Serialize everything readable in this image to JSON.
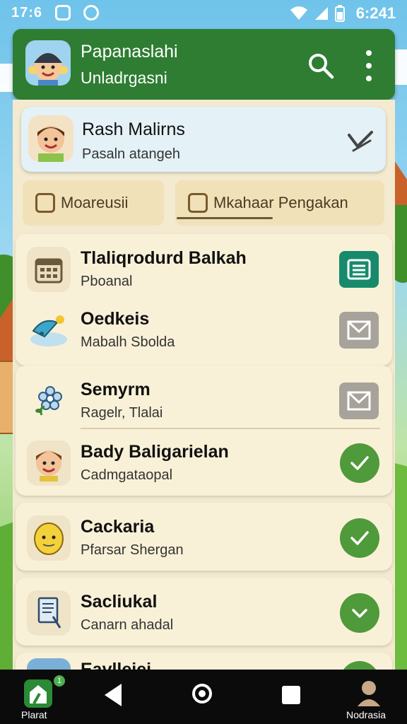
{
  "status_bar": {
    "time": "17:6",
    "clock": "6:241"
  },
  "app_bar": {
    "title": "Papanaslahi",
    "subtitle": "Unladrgasni"
  },
  "profile": {
    "name": "Rash Malirns",
    "subtitle": "Pasaln atangeh"
  },
  "tabs": [
    {
      "label": "Moareusii"
    },
    {
      "label": "Mkahaar Pengakan"
    }
  ],
  "list": [
    {
      "title": "Tlaliqrodurd Balkah",
      "subtitle": "Pboanal",
      "icon": "calendar-icon",
      "action": "list-icon",
      "action_color": "#178a6c"
    },
    {
      "title": "Oedkeis",
      "subtitle": "Mabalh Sbolda",
      "icon": "satellite-icon",
      "action": "mail-icon",
      "action_color": "#a7a29a"
    },
    {
      "title": "Semyrm",
      "subtitle": "Ragelr, Tlalai",
      "icon": "flower-icon",
      "action": "mail-icon",
      "action_color": "#a7a29a"
    },
    {
      "title": "Bady Baligarielan",
      "subtitle": "Cadmgataopal",
      "icon": "person-icon",
      "action": "check-icon",
      "action_color": "#4f9a3a"
    },
    {
      "title": "Cackaria",
      "subtitle": "Pfarsar Shergan",
      "icon": "smiley-icon",
      "action": "check-icon",
      "action_color": "#4f9a3a"
    },
    {
      "title": "Sacliukal",
      "subtitle": "Canarn ahadal",
      "icon": "document-icon",
      "action": "check-down-icon",
      "action_color": "#4f9a3a"
    },
    {
      "title": "Eavlleiei",
      "subtitle": "",
      "icon": "partial-icon",
      "action": "check-icon",
      "action_color": "#4f9a3a"
    }
  ],
  "nav": {
    "app_label": "Plarat",
    "app_badge": "1",
    "profile_label": "Nodrasia"
  },
  "colors": {
    "primary": "#2e7d32",
    "panel": "#f3ead0",
    "card": "#f9f1d7"
  }
}
